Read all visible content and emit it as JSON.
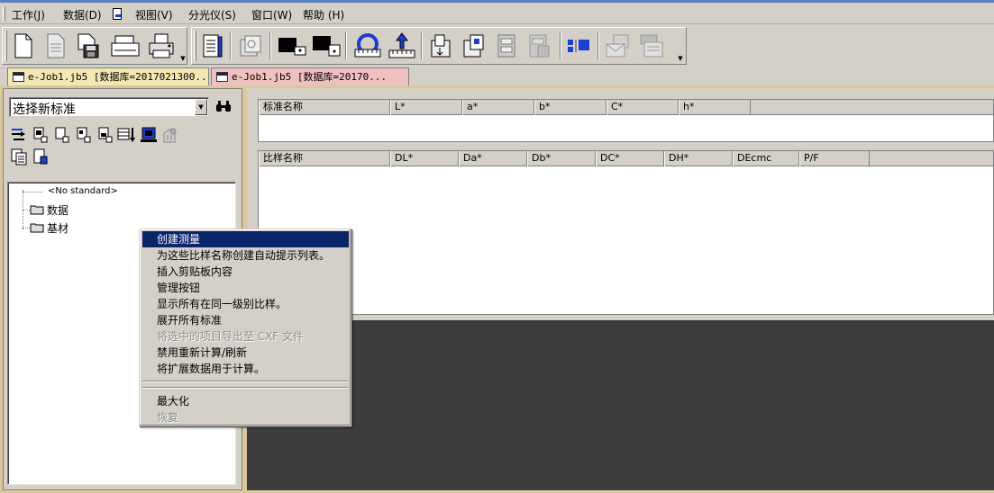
{
  "menubar": {
    "items": [
      {
        "label": "工作(J)"
      },
      {
        "label": "数据(D)"
      },
      {
        "label": "视图(V)"
      },
      {
        "label": "分光仪(S)"
      },
      {
        "label": "窗口(W)"
      },
      {
        "label": "帮助 (H)"
      }
    ]
  },
  "toolbar": {
    "icons": [
      "new-document-icon",
      "open-document-icon",
      "save-icon",
      "scanner-icon",
      "printer-icon",
      "report-icon",
      "preview-icon",
      "black-standard-icon",
      "black-sample-icon",
      "calibrate-icon",
      "measure-icon",
      "export-icon",
      "import-icon",
      "cabinet-icon",
      "cabinet-disabled-icon",
      "color-tiles-icon",
      "mail-disabled-icon",
      "list-disabled-icon"
    ]
  },
  "tabs": [
    {
      "label": "e-Job1.jb5 [数据库=2017021300..."
    },
    {
      "label": "e-Job1.jb5 [数据库=20170..."
    }
  ],
  "left_panel": {
    "standard_select": {
      "value": "选择新标准"
    },
    "tree": {
      "no_standard": "<No standard>",
      "items": [
        {
          "label": "数据"
        },
        {
          "label": "基材"
        }
      ]
    }
  },
  "standard_grid": {
    "columns": [
      "标准名称",
      "L*",
      "a*",
      "b*",
      "C*",
      "h*"
    ]
  },
  "sample_grid": {
    "columns": [
      "比样名称",
      "DL*",
      "Da*",
      "Db*",
      "DC*",
      "DH*",
      "DEcmc",
      "P/F"
    ]
  },
  "context_menu": {
    "items": [
      {
        "label": "创建测量",
        "selected": true,
        "disabled": false
      },
      {
        "label": "为这些比样名称创建自动提示列表。",
        "selected": false,
        "disabled": false
      },
      {
        "label": "插入剪贴板内容",
        "selected": false,
        "disabled": false
      },
      {
        "label": "管理按钮",
        "selected": false,
        "disabled": false
      },
      {
        "label": "显示所有在同一级别比样。",
        "selected": false,
        "disabled": false
      },
      {
        "label": "展开所有标准",
        "selected": false,
        "disabled": false
      },
      {
        "label": "将选中的项目导出至 CXF 文件",
        "selected": false,
        "disabled": true
      },
      {
        "label": "禁用重新计算/刷新",
        "selected": false,
        "disabled": false
      },
      {
        "label": "将扩展数据用于计算。",
        "selected": false,
        "disabled": false
      }
    ],
    "window_items": [
      {
        "label": "最大化",
        "disabled": false
      },
      {
        "label": "恢复",
        "disabled": true
      }
    ]
  },
  "colors": {
    "menu_highlight": "#0a246a",
    "tab_active": "#f0c0c0",
    "tab_inactive": "#f2e8b4",
    "frame": "#d9c89a",
    "workspace": "#3c3c3c"
  }
}
